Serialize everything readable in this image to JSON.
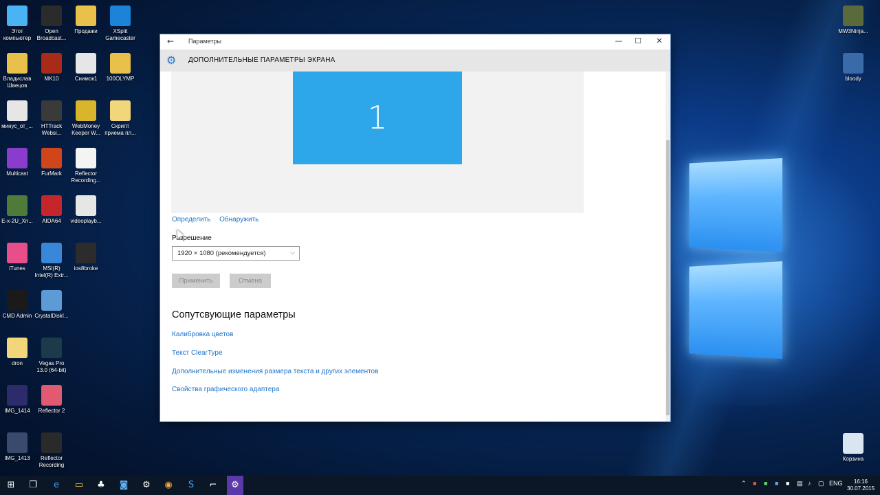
{
  "desktop": {
    "icons": [
      {
        "label": "Этот компьютер",
        "color": "#4ab3f4"
      },
      {
        "label": "Open Broadcast...",
        "color": "#2b2b2b"
      },
      {
        "label": "Продажи",
        "color": "#e8c04a"
      },
      {
        "label": "XSplit Gamecaster",
        "color": "#1b83d8"
      },
      {
        "label": "Владислав Швецов",
        "color": "#e8c04a"
      },
      {
        "label": "MK10",
        "color": "#a82a18"
      },
      {
        "label": "Снимок1",
        "color": "#e6e6e6"
      },
      {
        "label": "100OLYMP",
        "color": "#e8c04a"
      },
      {
        "label": "минус_от_...",
        "color": "#e6e6e6"
      },
      {
        "label": "HTTrack Websi...",
        "color": "#3a3a3a"
      },
      {
        "label": "WebMoney Keeper W...",
        "color": "#d9b52b"
      },
      {
        "label": "Скрипт приема пл...",
        "color": "#f2d67a"
      },
      {
        "label": "Multicast",
        "color": "#8a3ccc"
      },
      {
        "label": "FurMark",
        "color": "#d0451c"
      },
      {
        "label": "Reflector Recording...",
        "color": "#f4f4f4"
      },
      {
        "label": "E-x-2U_Xn...",
        "color": "#4e7a3a"
      },
      {
        "label": "AIDA64",
        "color": "#c4262b"
      },
      {
        "label": "videoplayb...",
        "color": "#e6e6e6"
      },
      {
        "label": "iTunes",
        "color": "#e84f8a"
      },
      {
        "label": "MSI(R) Intel(R) Extr...",
        "color": "#3a86d8"
      },
      {
        "label": "ios8broke",
        "color": "#2c2c2c"
      },
      {
        "label": "CMD Admin",
        "color": "#1a1a1a"
      },
      {
        "label": "CrystalDiskI...",
        "color": "#5d9bd6"
      },
      {
        "label": "dron",
        "color": "#f2d67a"
      },
      {
        "label": "Vegas Pro 13.0 (64-bit)",
        "color": "#1c3b4a"
      },
      {
        "label": "IMG_1414",
        "color": "#2c2c6c"
      },
      {
        "label": "Reflector 2",
        "color": "#e25a72"
      },
      {
        "label": "IMG_1413",
        "color": "#3a4a6c"
      },
      {
        "label": "Reflector Recording",
        "color": "#2a2a2a"
      }
    ],
    "right_icons": [
      {
        "label": "MW3Ninja...",
        "color": "#5a6a3a"
      },
      {
        "label": "bloody",
        "color": "#3a6aa8"
      },
      {
        "label": "Корзина",
        "color": "#d9e6f2"
      }
    ]
  },
  "window": {
    "title": "Параметры",
    "header_title": "ДОПОЛНИТЕЛЬНЫЕ ПАРАМЕТРЫ ЭКРАНА",
    "monitor_number": "1",
    "identify_link": "Определить",
    "detect_link": "Обнаружить",
    "resolution_label": "Разрешение",
    "resolution_value": "1920 × 1080 (рекомендуется)",
    "apply_label": "Применить",
    "cancel_label": "Отмена",
    "related_title": "Сопутсвующие параметры",
    "related_links": [
      "Калибровка цветов",
      "Текст ClearType",
      "Дополнительные изменения размера текста и других элементов",
      "Свойства графического адаптера"
    ]
  },
  "taskbar": {
    "language": "ENG",
    "time": "16:16",
    "date": "30.07.2015"
  },
  "colors": {
    "accent": "#1e73c9",
    "monitor": "#2ea7ea"
  }
}
